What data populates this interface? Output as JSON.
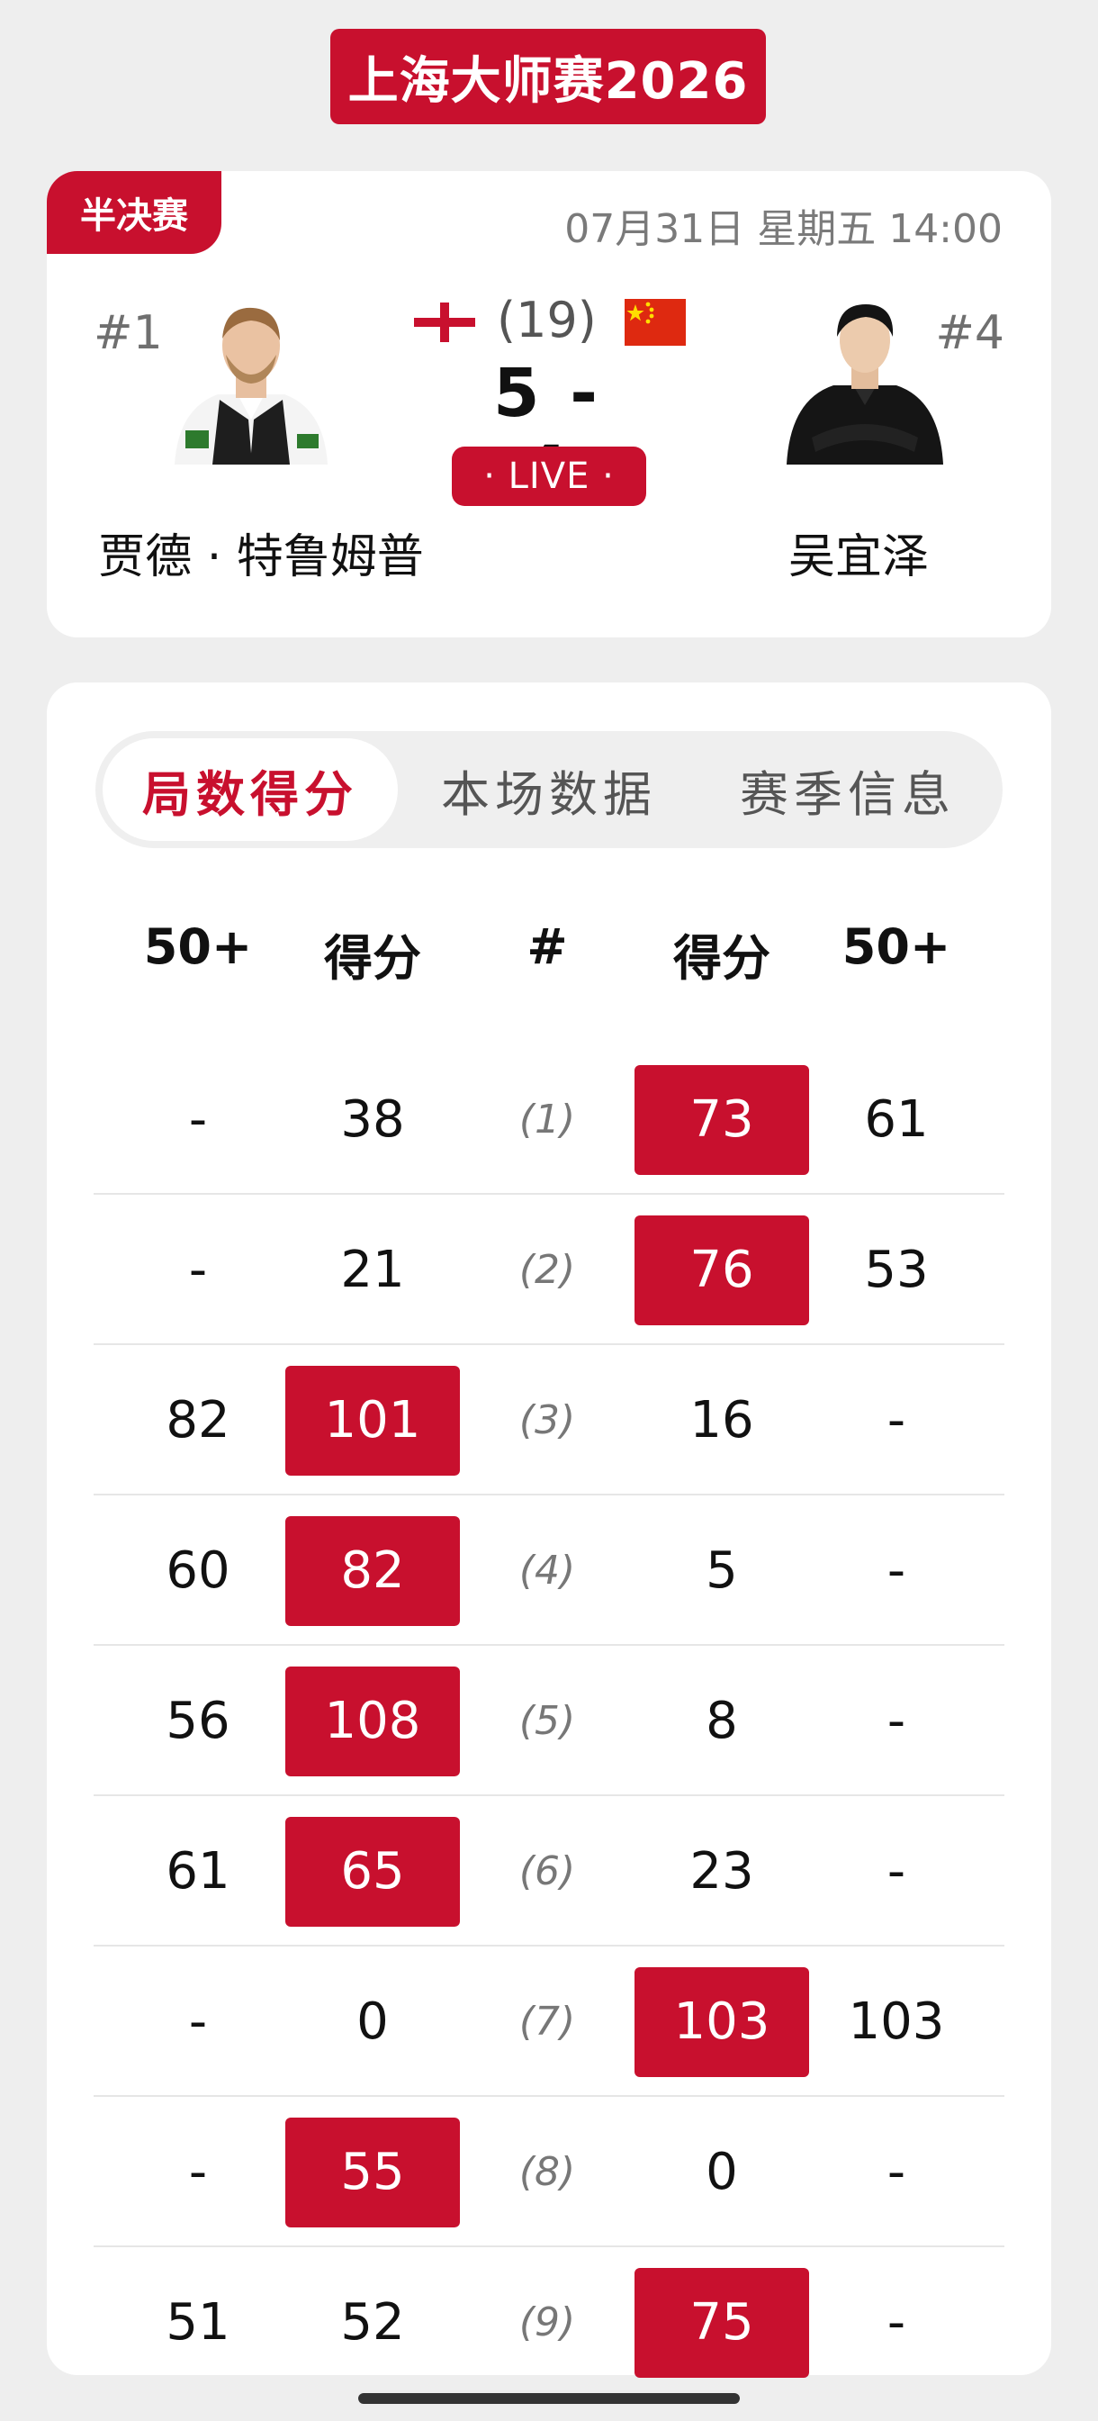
{
  "title": "上海大师赛2026",
  "match": {
    "round": "半决赛",
    "datetime": "07月31日 星期五 14:00",
    "left": {
      "seed": "#1",
      "name": "贾德 · 特鲁姆普"
    },
    "right": {
      "seed": "#4",
      "name": "吴宜泽"
    },
    "frames_total": "(19)",
    "score": "5 - 4",
    "live": "· LIVE ·"
  },
  "tabs": [
    "局数得分",
    "本场数据",
    "赛季信息"
  ],
  "columns": [
    "50+",
    "得分",
    "#",
    "得分",
    "50+"
  ],
  "frames": [
    {
      "left_break": "-",
      "left_score": "38",
      "num": "(1)",
      "right_score": "73",
      "right_break": "61",
      "winner": "right"
    },
    {
      "left_break": "-",
      "left_score": "21",
      "num": "(2)",
      "right_score": "76",
      "right_break": "53",
      "winner": "right"
    },
    {
      "left_break": "82",
      "left_score": "101",
      "num": "(3)",
      "right_score": "16",
      "right_break": "-",
      "winner": "left"
    },
    {
      "left_break": "60",
      "left_score": "82",
      "num": "(4)",
      "right_score": "5",
      "right_break": "-",
      "winner": "left"
    },
    {
      "left_break": "56",
      "left_score": "108",
      "num": "(5)",
      "right_score": "8",
      "right_break": "-",
      "winner": "left"
    },
    {
      "left_break": "61",
      "left_score": "65",
      "num": "(6)",
      "right_score": "23",
      "right_break": "-",
      "winner": "left"
    },
    {
      "left_break": "-",
      "left_score": "0",
      "num": "(7)",
      "right_score": "103",
      "right_break": "103",
      "winner": "right"
    },
    {
      "left_break": "-",
      "left_score": "55",
      "num": "(8)",
      "right_score": "0",
      "right_break": "-",
      "winner": "left"
    },
    {
      "left_break": "51",
      "left_score": "52",
      "num": "(9)",
      "right_score": "75",
      "right_break": "-",
      "winner": "right"
    }
  ],
  "colors": {
    "accent": "#c8102e",
    "background": "#eeeeee"
  }
}
